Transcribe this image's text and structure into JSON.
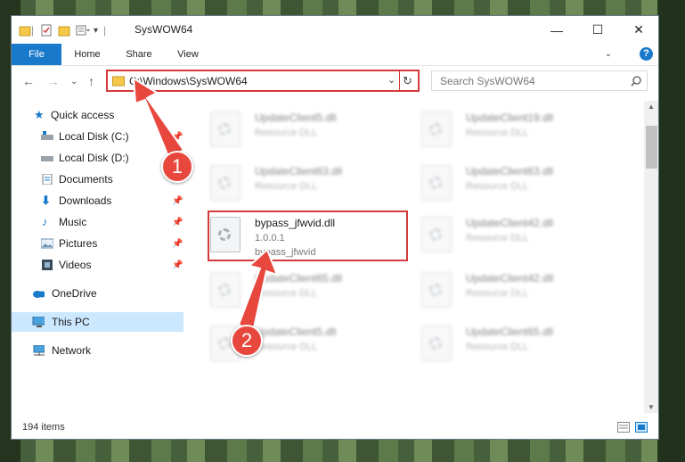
{
  "window": {
    "title": "SysWOW64"
  },
  "window_controls": {
    "minimize": "—",
    "maximize": "☐",
    "close": "✕"
  },
  "ribbon": {
    "tabs": [
      "File",
      "Home",
      "Share",
      "View"
    ],
    "help": "?"
  },
  "address": {
    "path": "C:\\Windows\\SysWOW64"
  },
  "search": {
    "placeholder": "Search SysWOW64"
  },
  "sidebar": {
    "items": [
      {
        "label": "Quick access",
        "pinned": false
      },
      {
        "label": "Local Disk (C:)",
        "pinned": true
      },
      {
        "label": "Local Disk (D:)",
        "pinned": false
      },
      {
        "label": "Documents",
        "pinned": true
      },
      {
        "label": "Downloads",
        "pinned": true
      },
      {
        "label": "Music",
        "pinned": true
      },
      {
        "label": "Pictures",
        "pinned": true
      },
      {
        "label": "Videos",
        "pinned": true
      },
      {
        "label": "OneDrive",
        "pinned": false
      },
      {
        "label": "This PC",
        "pinned": false,
        "selected": true
      },
      {
        "label": "Network",
        "pinned": false
      }
    ]
  },
  "files": {
    "highlighted": {
      "name": "bypass_jfwvid.dll",
      "version": "1.0.0.1",
      "description": "bypass_jfwvid"
    },
    "blurred_left": [
      {
        "name": "UpdateClient5.dll",
        "description": "Resource DLL"
      },
      {
        "name": "UpdateClient63.dll",
        "description": "Resource DLL"
      },
      {
        "name": "UpdateClient65.dll",
        "description": "Resource DLL"
      },
      {
        "name": "UpdateClient5.dll",
        "description": "Resource DLL"
      }
    ],
    "blurred_right": [
      {
        "name": "UpdateClient19.dll",
        "description": "Resource DLL"
      },
      {
        "name": "UpdateClient63.dll",
        "description": "Resource DLL"
      },
      {
        "name": "UpdateClient42.dll",
        "description": "Resource DLL"
      },
      {
        "name": "UpdateClient42.dll",
        "description": "Resource DLL"
      },
      {
        "name": "UpdateClient65.dll",
        "description": "Resource DLL"
      }
    ]
  },
  "status": {
    "item_count": "194 items"
  },
  "annotations": {
    "step1": "1",
    "step2": "2"
  },
  "colors": {
    "accent": "#1979ca",
    "highlight": "#d43a3a",
    "callout": "#e8473e"
  }
}
